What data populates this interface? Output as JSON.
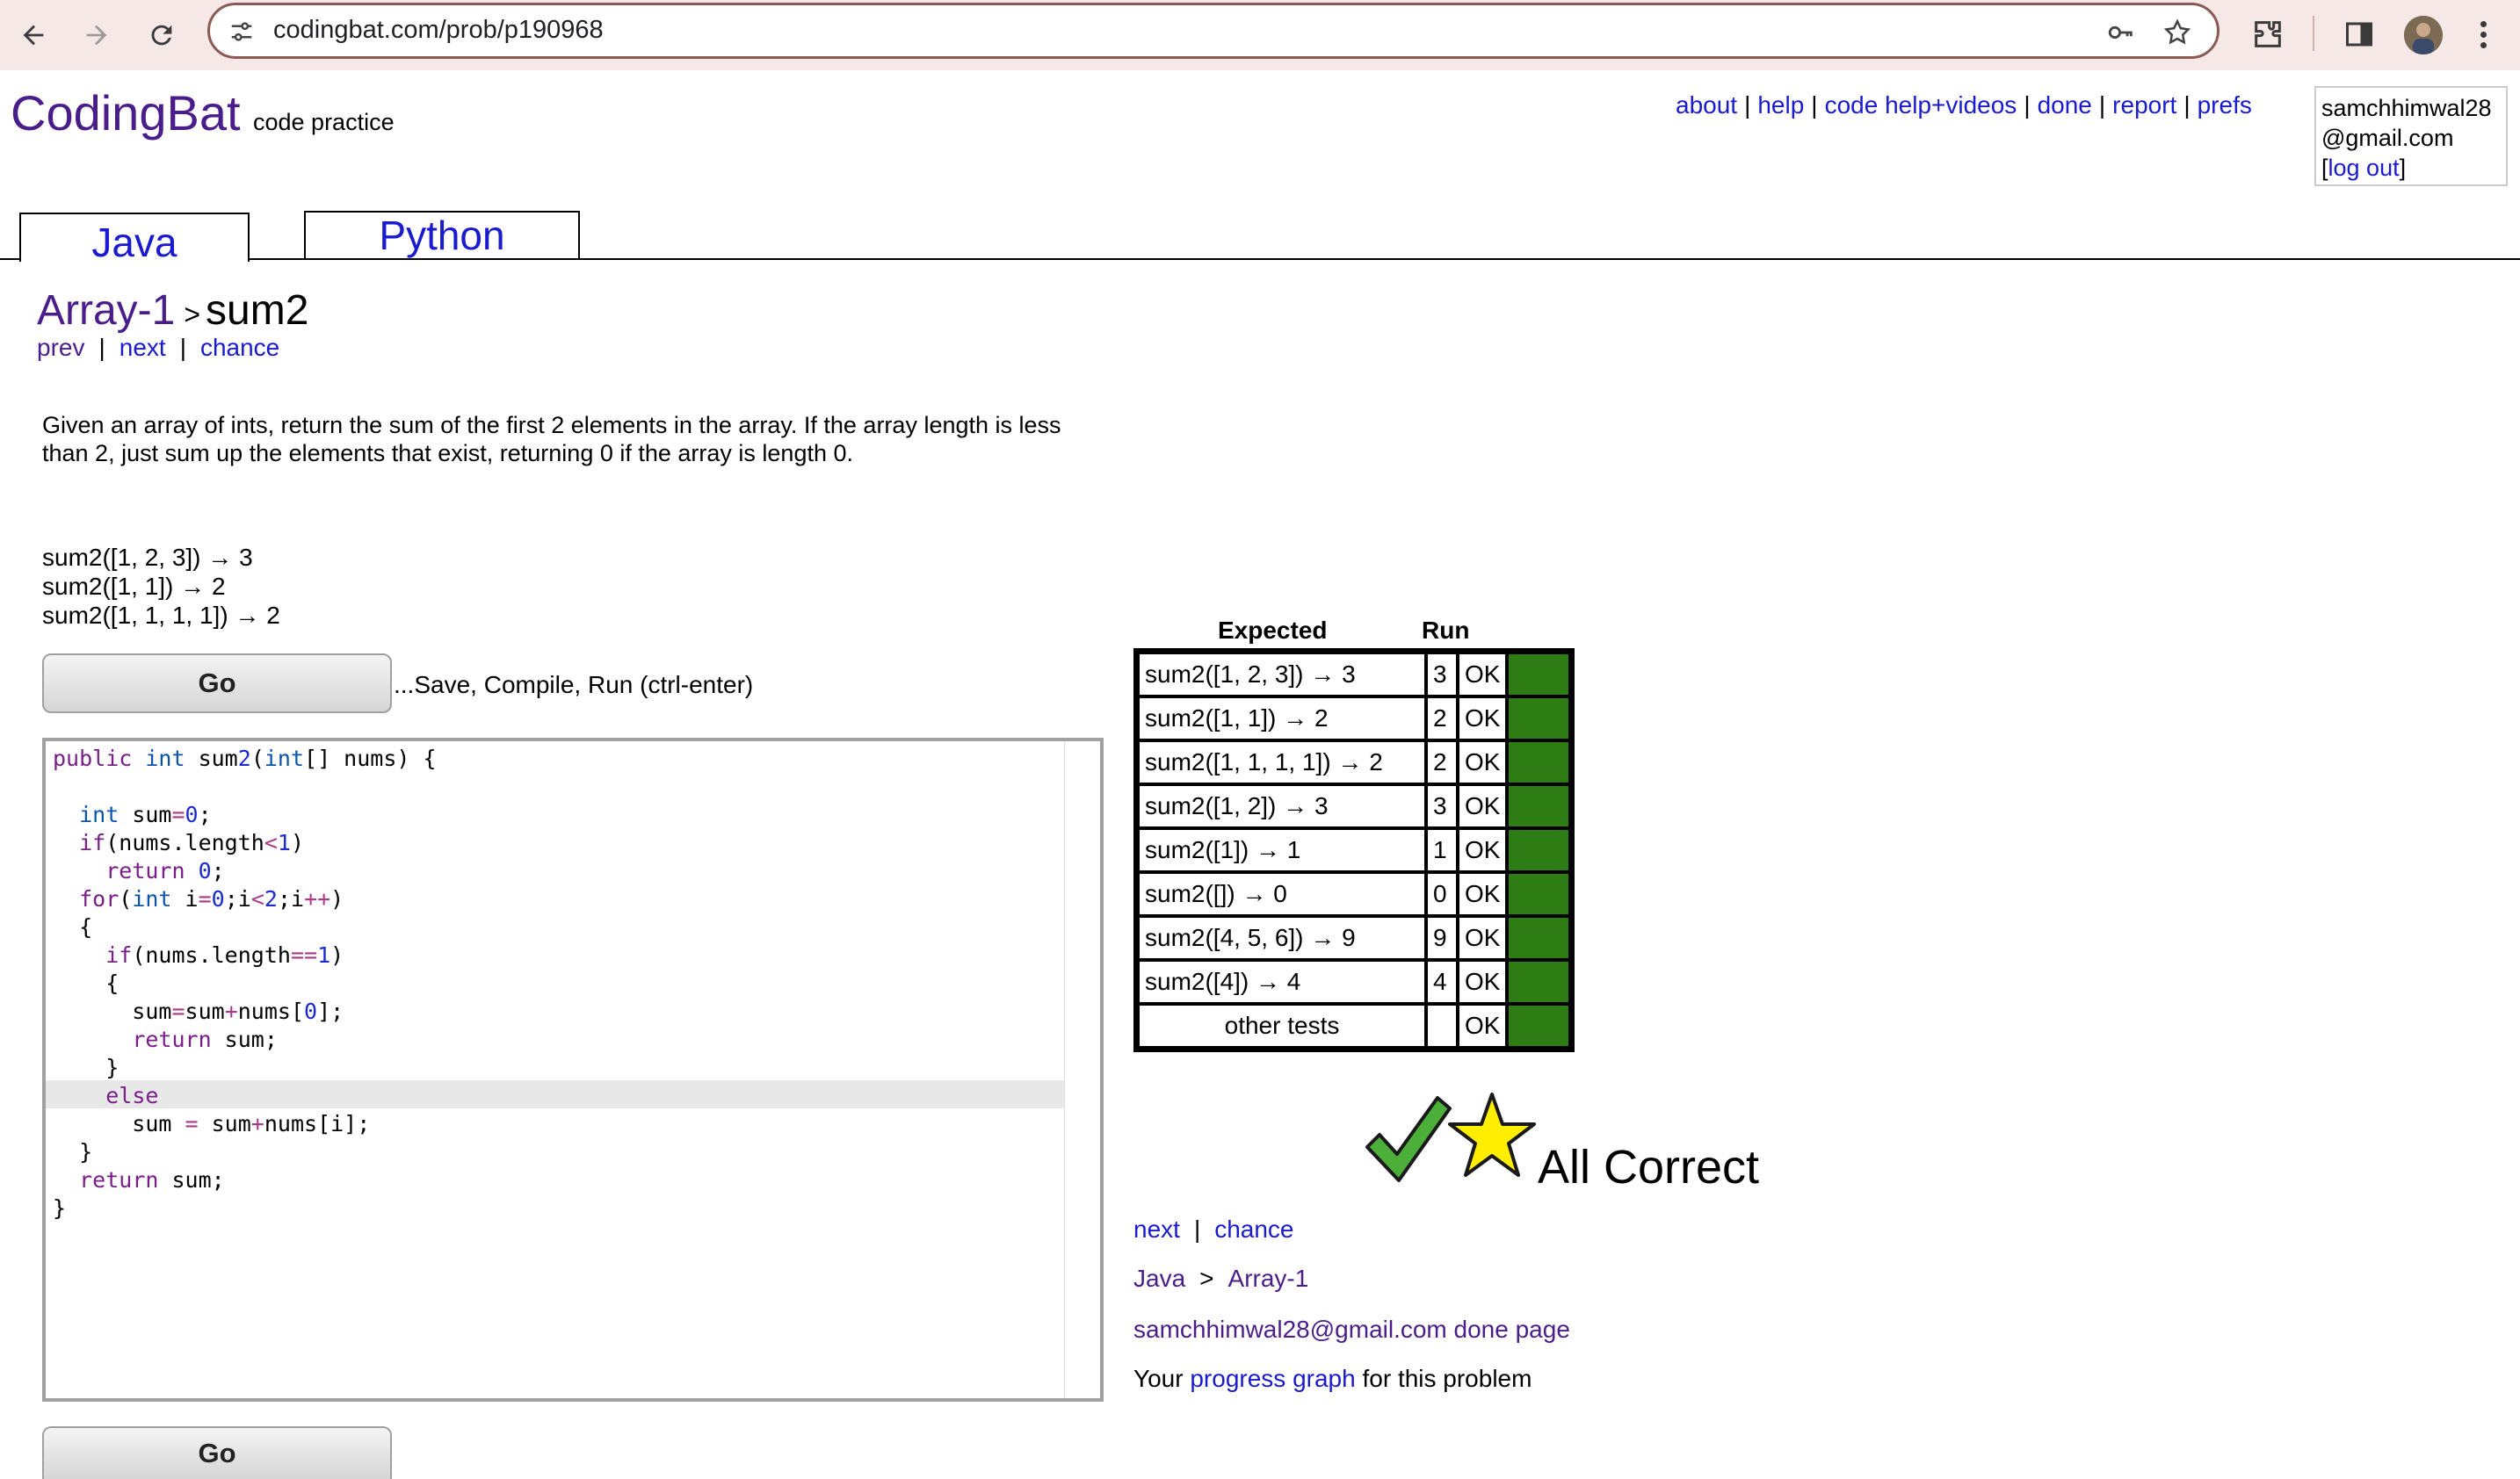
{
  "browser": {
    "url": "codingbat.com/prob/p190968"
  },
  "header": {
    "logo": "CodingBat",
    "logo_sub": "code practice",
    "links": [
      "about",
      "help",
      "code help+videos",
      "done",
      "report",
      "prefs"
    ],
    "user_line1": "samchhimwal28",
    "user_line2": "@gmail.com",
    "logout_label": "log out"
  },
  "tabs": [
    {
      "label": "Java",
      "active": true
    },
    {
      "label": "Python",
      "active": false
    }
  ],
  "problem": {
    "section": "Array-1",
    "separator": ">",
    "name": "sum2",
    "nav": [
      "prev",
      "next",
      "chance"
    ],
    "description": "Given an array of ints, return the sum of the first 2 elements in the array. If the array length is less than 2, just sum up the elements that exist, returning 0 if the array is length 0.",
    "examples": [
      "sum2([1, 2, 3]) → 3",
      "sum2([1, 1]) → 2",
      "sum2([1, 1, 1, 1]) → 2"
    ]
  },
  "actions": {
    "go_label": "Go",
    "go_hint": "...Save, Compile, Run (ctrl-enter)"
  },
  "editor": {
    "code": "public int sum2(int[] nums) {\n\n  int sum=0;\n  if(nums.length<1)\n    return 0;\n  for(int i=0;i<2;i++)\n  {\n    if(nums.length==1)\n    {\n      sum=sum+nums[0];\n      return sum;\n    }\n    else\n      sum = sum+nums[i];\n  }\n  return sum;\n}"
  },
  "results": {
    "expected_header": "Expected",
    "run_header": "Run",
    "rows": [
      {
        "expected": "sum2([1, 2, 3]) → 3",
        "run": "3",
        "status": "OK"
      },
      {
        "expected": "sum2([1, 1]) → 2",
        "run": "2",
        "status": "OK"
      },
      {
        "expected": "sum2([1, 1, 1, 1]) → 2",
        "run": "2",
        "status": "OK"
      },
      {
        "expected": "sum2([1, 2]) → 3",
        "run": "3",
        "status": "OK"
      },
      {
        "expected": "sum2([1]) → 1",
        "run": "1",
        "status": "OK"
      },
      {
        "expected": "sum2([]) → 0",
        "run": "0",
        "status": "OK"
      },
      {
        "expected": "sum2([4, 5, 6]) → 9",
        "run": "9",
        "status": "OK"
      },
      {
        "expected": "sum2([4]) → 4",
        "run": "4",
        "status": "OK"
      },
      {
        "expected": "other tests",
        "run": "",
        "status": "OK"
      }
    ],
    "pass_color": "#2e7d14",
    "summary": "All Correct"
  },
  "after": {
    "nav": [
      "next",
      "chance"
    ],
    "crumb_lang": "Java",
    "crumb_sep": ">",
    "crumb_section": "Array-1",
    "done_link": "samchhimwal28@gmail.com done page",
    "graph_prefix": "Your ",
    "graph_link": "progress graph",
    "graph_suffix": " for this problem"
  }
}
